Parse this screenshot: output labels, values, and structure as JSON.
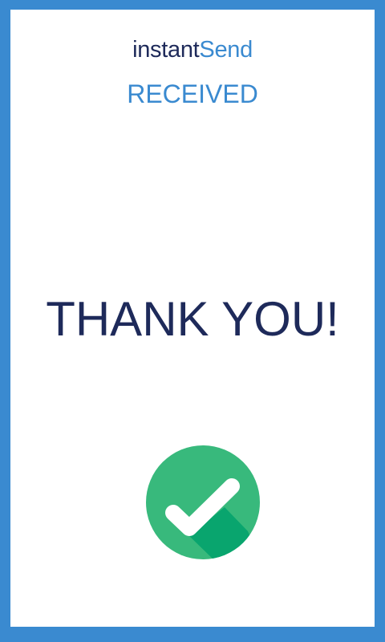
{
  "brand": {
    "part1": "instant",
    "part2": "Send"
  },
  "status": {
    "label": "RECEIVED"
  },
  "message": {
    "headline": "THANK YOU!"
  },
  "icon": {
    "name": "checkmark-circle-icon",
    "circle_color": "#38b97c",
    "shadow_color": "#09a56e",
    "check_color": "#ffffff"
  },
  "colors": {
    "frame": "#3a8ad0",
    "brand_dark": "#1e2a5a",
    "accent": "#3a8ad0",
    "background": "#ffffff"
  }
}
